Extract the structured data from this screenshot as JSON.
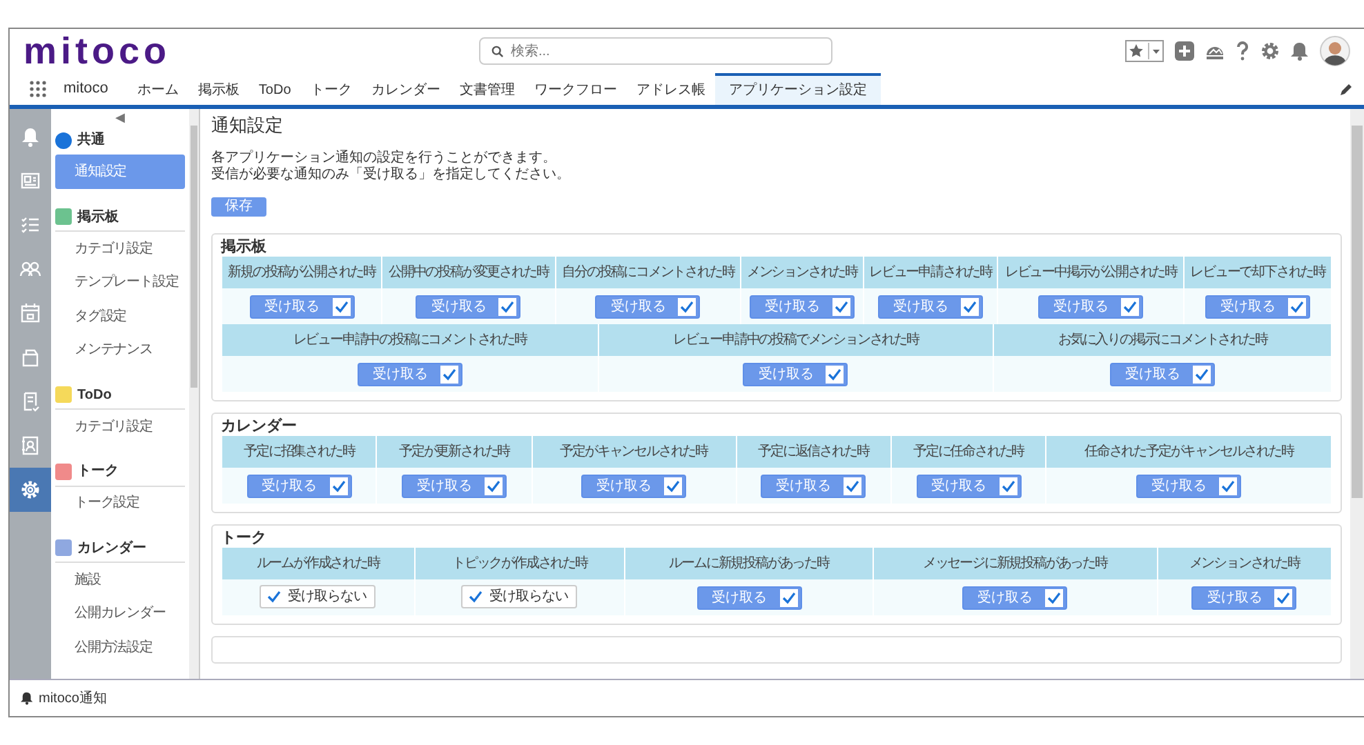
{
  "header": {
    "logo": "mitoco",
    "search": {
      "placeholder": "検索..."
    }
  },
  "nav": {
    "app_name": "mitoco",
    "tabs": [
      {
        "label": "ホーム",
        "selected": false
      },
      {
        "label": "掲示板",
        "selected": false
      },
      {
        "label": "ToDo",
        "selected": false
      },
      {
        "label": "トーク",
        "selected": false
      },
      {
        "label": "カレンダー",
        "selected": false
      },
      {
        "label": "文書管理",
        "selected": false
      },
      {
        "label": "ワークフロー",
        "selected": false
      },
      {
        "label": "アドレス帳",
        "selected": false
      },
      {
        "label": "アプリケーション設定",
        "selected": true
      }
    ]
  },
  "rail": [
    {
      "selected": false
    },
    {
      "selected": false
    },
    {
      "selected": false
    },
    {
      "selected": false
    },
    {
      "selected": false
    },
    {
      "selected": false
    },
    {
      "selected": false
    },
    {
      "selected": false
    },
    {
      "selected": true
    }
  ],
  "sidebar": {
    "collapse": "◀",
    "sections": [
      {
        "title": "共通",
        "color": "#1a73d9",
        "items": [
          {
            "label": "通知設定",
            "selected": true
          }
        ]
      },
      {
        "title": "掲示板",
        "color": "#6cc28f",
        "items": [
          {
            "label": "カテゴリ設定",
            "selected": false
          },
          {
            "label": "テンプレート設定",
            "selected": false
          },
          {
            "label": "タグ設定",
            "selected": false
          },
          {
            "label": "メンテナンス",
            "selected": false
          }
        ]
      },
      {
        "title": "ToDo",
        "color": "#f5d95a",
        "items": [
          {
            "label": "カテゴリ設定",
            "selected": false
          }
        ]
      },
      {
        "title": "トーク",
        "color": "#f08a8a",
        "items": [
          {
            "label": "トーク設定",
            "selected": false
          }
        ]
      },
      {
        "title": "カレンダー",
        "color": "#8fa8e0",
        "items": [
          {
            "label": "施設",
            "selected": false
          },
          {
            "label": "公開カレンダー",
            "selected": false
          },
          {
            "label": "公開方法設定",
            "selected": false
          }
        ]
      }
    ]
  },
  "page": {
    "title": "通知設定",
    "description": [
      "各アプリケーション通知の設定を行うことができます。",
      "受信が必要な通知のみ「受け取る」を指定してください。"
    ],
    "save_button": "保存",
    "panels": [
      {
        "title": "掲示板",
        "tables": [
          {
            "cells": [
              {
                "event": "新規の投稿が公開された時",
                "receive": true,
                "checked": true,
                "label": "受け取る"
              },
              {
                "event": "公開中の投稿が変更された時",
                "receive": true,
                "checked": true,
                "label": "受け取る"
              },
              {
                "event": "自分の投稿にコメントされた時",
                "receive": true,
                "checked": true,
                "label": "受け取る"
              },
              {
                "event": "メンションされた時",
                "receive": true,
                "checked": true,
                "label": "受け取る"
              },
              {
                "event": "レビュー申請された時",
                "receive": true,
                "checked": true,
                "label": "受け取る"
              },
              {
                "event": "レビュー中掲示が公開された時",
                "receive": true,
                "checked": true,
                "label": "受け取る"
              },
              {
                "event": "レビューで却下された時",
                "receive": true,
                "checked": true,
                "label": "受け取る"
              }
            ]
          },
          {
            "cells": [
              {
                "event": "レビュー申請中の投稿にコメントされた時",
                "receive": true,
                "checked": true,
                "label": "受け取る"
              },
              {
                "event": "レビュー申請中の投稿でメンションされた時",
                "receive": true,
                "checked": true,
                "label": "受け取る"
              },
              {
                "event": "お気に入りの掲示にコメントされた時",
                "receive": true,
                "checked": true,
                "label": "受け取る"
              }
            ]
          }
        ]
      },
      {
        "title": "カレンダー",
        "tables": [
          {
            "cells": [
              {
                "event": "予定に招集された時",
                "receive": true,
                "checked": true,
                "label": "受け取る"
              },
              {
                "event": "予定が更新された時",
                "receive": true,
                "checked": true,
                "label": "受け取る"
              },
              {
                "event": "予定がキャンセルされた時",
                "receive": true,
                "checked": true,
                "label": "受け取る"
              },
              {
                "event": "予定に返信された時",
                "receive": true,
                "checked": true,
                "label": "受け取る"
              },
              {
                "event": "予定に任命された時",
                "receive": true,
                "checked": true,
                "label": "受け取る"
              },
              {
                "event": "任命された予定がキャンセルされた時",
                "receive": true,
                "checked": true,
                "label": "受け取る"
              }
            ]
          }
        ]
      },
      {
        "title": "トーク",
        "tables": [
          {
            "cells": [
              {
                "event": "ルームが作成された時",
                "receive": false,
                "checked": true,
                "label": "受け取らない"
              },
              {
                "event": "トピックが作成された時",
                "receive": false,
                "checked": true,
                "label": "受け取らない"
              },
              {
                "event": "ルームに新規投稿があった時",
                "receive": true,
                "checked": true,
                "label": "受け取る"
              },
              {
                "event": "メッセージに新規投稿があった時",
                "receive": true,
                "checked": true,
                "label": "受け取る"
              },
              {
                "event": "メンションされた時",
                "receive": true,
                "checked": true,
                "label": "受け取る"
              }
            ]
          }
        ]
      }
    ]
  },
  "footer": {
    "label": "mitoco通知"
  }
}
